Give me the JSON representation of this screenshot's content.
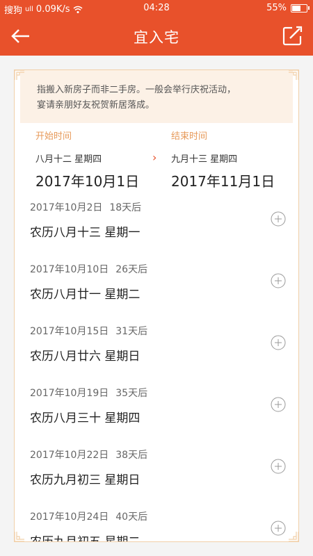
{
  "status_bar": {
    "carrier": "搜狗",
    "signal_text": "ull",
    "speed": "0.09K/s",
    "time": "04:28",
    "battery": "55%"
  },
  "header": {
    "title": "宜入宅"
  },
  "description": {
    "line1": "指搬入新房子而非二手房。一般会举行庆祝活动，",
    "line2": "宴请亲朋好友祝贺新居落成。"
  },
  "range": {
    "start_label": "开始时间",
    "start_lunar": "八月十二 星期四",
    "start_date": "2017年10月1日",
    "end_label": "结束时间",
    "end_lunar": "九月十三 星期四",
    "end_date": "2017年11月1日"
  },
  "items": [
    {
      "date": "2017年10月2日",
      "days": "18天后",
      "lunar": "农历八月十三 星期一"
    },
    {
      "date": "2017年10月10日",
      "days": "26天后",
      "lunar": "农历八月廿一 星期二"
    },
    {
      "date": "2017年10月15日",
      "days": "31天后",
      "lunar": "农历八月廿六 星期日"
    },
    {
      "date": "2017年10月19日",
      "days": "35天后",
      "lunar": "农历八月三十 星期四"
    },
    {
      "date": "2017年10月22日",
      "days": "38天后",
      "lunar": "农历九月初三 星期日"
    },
    {
      "date": "2017年10月24日",
      "days": "40天后",
      "lunar": "农历九月初五 星期二"
    }
  ],
  "colors": {
    "accent": "#e8512b",
    "label_orange": "#e79a5a",
    "desc_bg": "#fcf1e6"
  }
}
